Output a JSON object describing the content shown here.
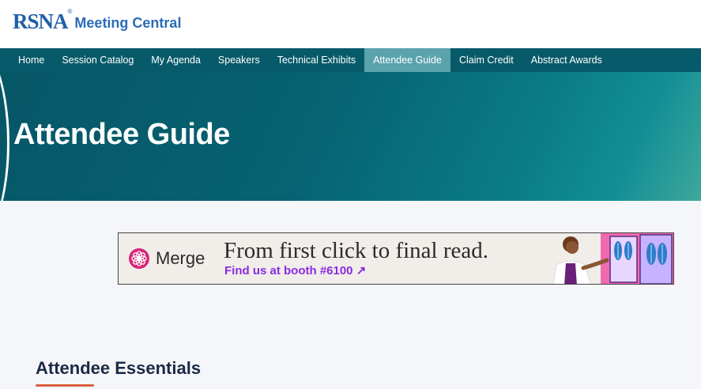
{
  "header": {
    "logo_mark": "RSNA",
    "logo_registered": "®",
    "logo_text": "Meeting Central"
  },
  "nav": {
    "items": [
      {
        "label": "Home"
      },
      {
        "label": "Session Catalog"
      },
      {
        "label": "My Agenda"
      },
      {
        "label": "Speakers"
      },
      {
        "label": "Technical Exhibits"
      },
      {
        "label": "Attendee Guide",
        "active": true
      },
      {
        "label": "Claim Credit"
      },
      {
        "label": "Abstract Awards"
      }
    ]
  },
  "hero": {
    "title": "Attendee Guide"
  },
  "ad": {
    "brand": "Merge",
    "headline": "From first click to final read.",
    "cta": "Find us at booth #6100 ↗",
    "colors": {
      "cta": "#8a2be2",
      "brand_icon": "#d6287a"
    }
  },
  "section": {
    "title": "Attendee Essentials"
  },
  "colors": {
    "nav_bg": "#075a6a",
    "nav_active": "#5aa3ad",
    "brand_blue": "#1f5fa8",
    "accent_underline": "#d9603b"
  }
}
